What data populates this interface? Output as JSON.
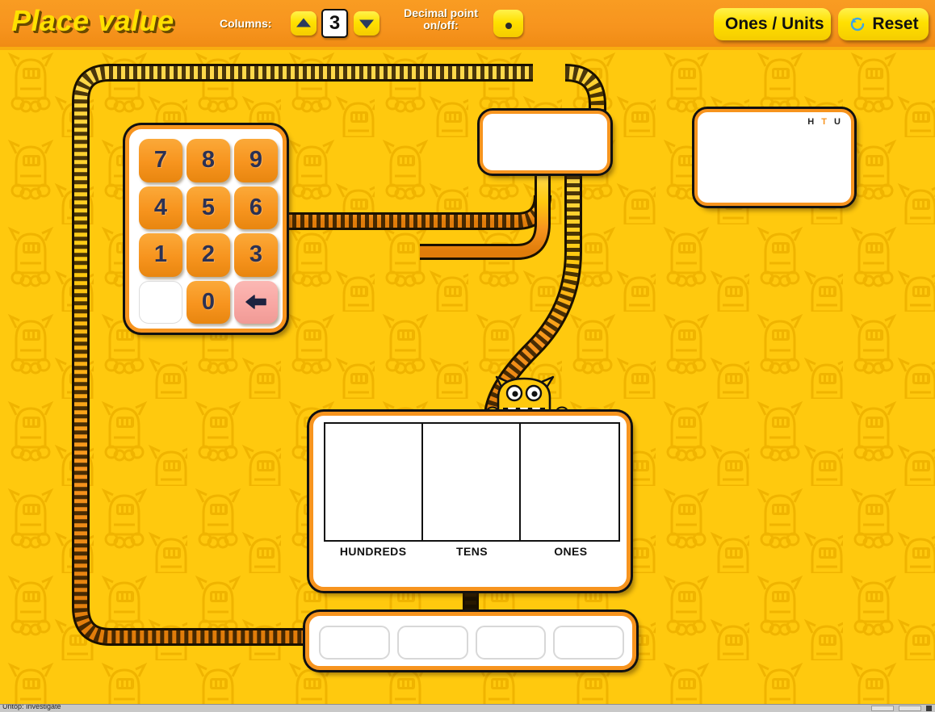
{
  "header": {
    "title": "Place value",
    "columns_label": "Columns:",
    "columns_up_icon": "triangle-up-icon",
    "columns_down_icon": "triangle-down-icon",
    "columns_value": "3",
    "decimal_label_line1": "Decimal point",
    "decimal_label_line2": "on/off:",
    "decimal_icon": "decimal-point-dot-icon",
    "ones_units_label": "Ones / Units",
    "reset_label": "Reset",
    "reset_icon": "refresh-circle-icon"
  },
  "keypad": {
    "keys": [
      {
        "label": "7",
        "type": "digit",
        "name": "key-7"
      },
      {
        "label": "8",
        "type": "digit",
        "name": "key-8"
      },
      {
        "label": "9",
        "type": "digit",
        "name": "key-9"
      },
      {
        "label": "4",
        "type": "digit",
        "name": "key-4"
      },
      {
        "label": "5",
        "type": "digit",
        "name": "key-5"
      },
      {
        "label": "6",
        "type": "digit",
        "name": "key-6"
      },
      {
        "label": "1",
        "type": "digit",
        "name": "key-1"
      },
      {
        "label": "2",
        "type": "digit",
        "name": "key-2"
      },
      {
        "label": "3",
        "type": "digit",
        "name": "key-3"
      },
      {
        "label": "",
        "type": "blank",
        "name": "key-blank"
      },
      {
        "label": "0",
        "type": "digit",
        "name": "key-0"
      },
      {
        "label": "",
        "type": "backspace",
        "name": "key-backspace",
        "icon": "arrow-left-icon"
      }
    ]
  },
  "display_panel": {
    "value": ""
  },
  "htu_panel": {
    "value": "",
    "labels": {
      "h": "H",
      "t": "T",
      "u": "U"
    },
    "highlight_color": "#f7941e"
  },
  "place_value_table": {
    "headers": [
      "HUNDREDS",
      "TENS",
      "ONES"
    ],
    "cells": [
      "",
      "",
      ""
    ]
  },
  "tray": {
    "slots": [
      "",
      "",
      "",
      ""
    ]
  },
  "monster": {
    "name": "monster-character",
    "body_color": "#ffc90e"
  },
  "status": {
    "text": "Untop: Investigate"
  },
  "colors": {
    "background": "#ffc90e",
    "header": "#f7941e",
    "title": "#ffe000",
    "accent_orange": "#f7941e",
    "button_yellow": "#ffe000",
    "backspace_pink": "#f8a7a3",
    "digit_text": "#2b3154"
  }
}
